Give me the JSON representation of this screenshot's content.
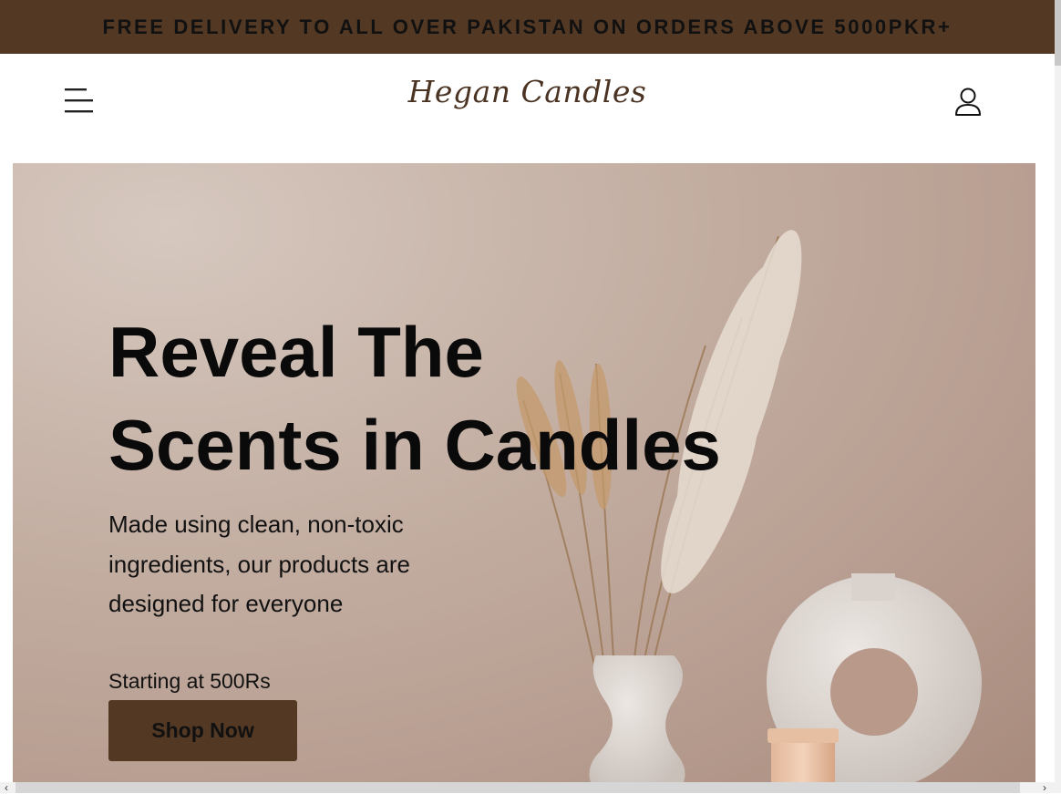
{
  "announcement": {
    "text": "FREE DELIVERY TO ALL OVER PAKISTAN ON ORDERS ABOVE 5000PKR+"
  },
  "header": {
    "brand": "Hegan Candles",
    "menu_icon": "hamburger-menu-icon",
    "account_icon": "user-account-icon"
  },
  "hero": {
    "title_line1": "Reveal The",
    "title_line2": "Scents in Candles",
    "description": "Made using clean, non-toxic ingredients, our products are designed for everyone",
    "price_note": "Starting at 500Rs",
    "cta_label": "Shop Now"
  },
  "colors": {
    "brand_brown": "#533823",
    "text_dark": "#111111",
    "hero_bg": "#c4afa3"
  },
  "scrollbar": {
    "left_arrow": "‹",
    "right_arrow": "›"
  }
}
